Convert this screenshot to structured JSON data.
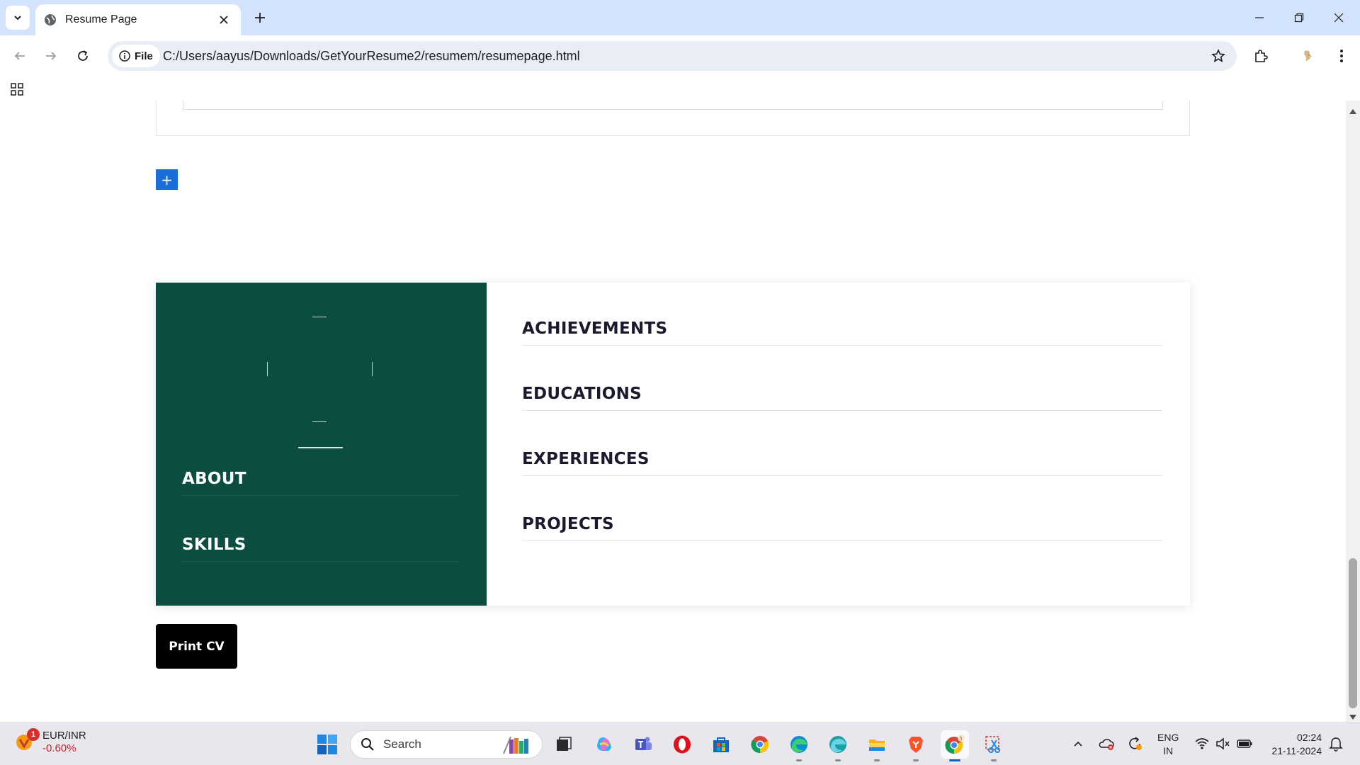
{
  "browser": {
    "tab_title": "Resume Page",
    "site_chip_label": "File",
    "url": "C:/Users/aayus/Downloads/GetYourResume2/resumem/resumepage.html"
  },
  "page": {
    "add_button_label": "+",
    "resume_left_sections": [
      "ABOUT",
      "SKILLS"
    ],
    "resume_right_sections": [
      "ACHIEVEMENTS",
      "EDUCATIONS",
      "EXPERIENCES",
      "PROJECTS"
    ],
    "print_button_label": "Print CV",
    "colors": {
      "sidebar_bg": "#0b4d41",
      "add_button_bg": "#1a6dd6",
      "print_button_bg": "#000000",
      "heading_text": "#1a1a2e"
    }
  },
  "taskbar": {
    "widget_badge": "1",
    "widget_title": "EUR/INR",
    "widget_value": "-0.60%",
    "search_placeholder": "Search",
    "lang_line1": "ENG",
    "lang_line2": "IN",
    "time": "02:24",
    "date": "21-11-2024",
    "apps": [
      "task-view",
      "copilot",
      "teams",
      "opera",
      "microsoft-store",
      "chrome",
      "edge",
      "edge-beta",
      "file-explorer",
      "brave",
      "chrome-active",
      "snipping-tool"
    ]
  }
}
